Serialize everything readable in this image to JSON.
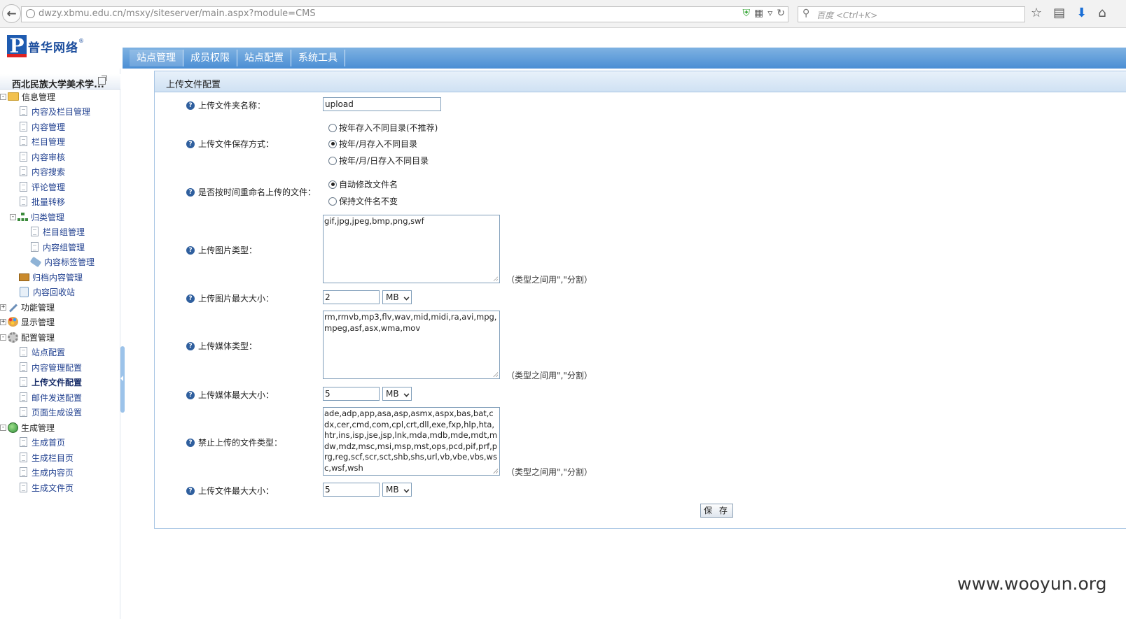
{
  "browser": {
    "url": "dwzy.xbmu.edu.cn/msxy/siteserver/main.aspx?module=CMS",
    "search_placeholder": "百度 <Ctrl+K>"
  },
  "header": {
    "logo_text": "普华网络",
    "logo_reg": "®",
    "nav_tabs": [
      "站点管理",
      "成员权限",
      "站点配置",
      "系统工具"
    ]
  },
  "sidebar": {
    "site_title": "西北民族大学美术学...",
    "tree": [
      {
        "label": "信息管理"
      },
      {
        "label": "内容及栏目管理"
      },
      {
        "label": "内容管理"
      },
      {
        "label": "栏目管理"
      },
      {
        "label": "内容审核"
      },
      {
        "label": "内容搜索"
      },
      {
        "label": "评论管理"
      },
      {
        "label": "批量转移"
      },
      {
        "label": "归类管理"
      },
      {
        "label": "栏目组管理"
      },
      {
        "label": "内容组管理"
      },
      {
        "label": "内容标签管理"
      },
      {
        "label": "归档内容管理"
      },
      {
        "label": "内容回收站"
      },
      {
        "label": "功能管理"
      },
      {
        "label": "显示管理"
      },
      {
        "label": "配置管理"
      },
      {
        "label": "站点配置"
      },
      {
        "label": "内容管理配置"
      },
      {
        "label": "上传文件配置"
      },
      {
        "label": "邮件发送配置"
      },
      {
        "label": "页面生成设置"
      },
      {
        "label": "生成管理"
      },
      {
        "label": "生成首页"
      },
      {
        "label": "生成栏目页"
      },
      {
        "label": "生成内容页"
      },
      {
        "label": "生成文件页"
      }
    ]
  },
  "panel": {
    "title": "上传文件配置",
    "fields": {
      "folder_name": {
        "label": "上传文件夹名称：",
        "value": "upload"
      },
      "save_mode": {
        "label": "上传文件保存方式：",
        "options": [
          "按年存入不同目录(不推荐)",
          "按年/月存入不同目录",
          "按年/月/日存入不同目录"
        ],
        "selected": "按年/月存入不同目录"
      },
      "rename": {
        "label": "是否按时间重命名上传的文件：",
        "options": [
          "自动修改文件名",
          "保持文件名不变"
        ],
        "selected": "自动修改文件名"
      },
      "image_types": {
        "label": "上传图片类型：",
        "value": "gif,jpg,jpeg,bmp,png,swf"
      },
      "image_max": {
        "label": "上传图片最大大小：",
        "value": "2",
        "unit": "MB"
      },
      "media_types": {
        "label": "上传媒体类型：",
        "value": "rm,rmvb,mp3,flv,wav,mid,midi,ra,avi,mpg,mpeg,asf,asx,wma,mov"
      },
      "media_max": {
        "label": "上传媒体最大大小：",
        "value": "5",
        "unit": "MB"
      },
      "forbidden_types": {
        "label": "禁止上传的文件类型：",
        "value": "ade,adp,app,asa,asp,asmx,aspx,bas,bat,cdx,cer,cmd,com,cpl,crt,dll,exe,fxp,hlp,hta,htr,ins,isp,jse,jsp,lnk,mda,mdb,mde,mdt,mdw,mdz,msc,msi,msp,mst,ops,pcd,pif,prf,prg,reg,scf,scr,sct,shb,shs,url,vb,vbe,vbs,wsc,wsf,wsh"
      },
      "file_max": {
        "label": "上传文件最大大小：",
        "value": "5",
        "unit": "MB"
      }
    },
    "hint": "（类型之间用\",\"分割）",
    "save_label": "保 存"
  },
  "watermark": "www.wooyun.org"
}
